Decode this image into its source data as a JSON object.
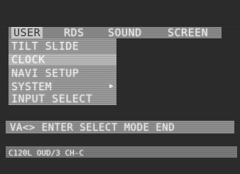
{
  "menu": {
    "tabs": [
      {
        "label": "USER"
      },
      {
        "label": "RDS"
      },
      {
        "label": "SOUND"
      },
      {
        "label": "SCREEN"
      }
    ],
    "active_tab": "USER"
  },
  "dropdown": {
    "items": [
      {
        "label": "TILT SLIDE"
      },
      {
        "label": "CLOCK"
      },
      {
        "label": "NAVI SETUP"
      },
      {
        "label": "SYSTEM"
      },
      {
        "label": "INPUT SELECT"
      }
    ],
    "selected_item": "CLOCK",
    "submenu_arrow_icon": "triangle-right-icon",
    "submenu_arrow_glyph": "▶"
  },
  "help_bar": {
    "text": "VA<> ENTER SELECT MODE END"
  },
  "status_bar": {
    "text": "C120L OUD/3 CH-C"
  },
  "colors": {
    "screen_bg": "#2d2d2d",
    "bar_bg": "#8a8a8a",
    "highlight_bg": "#b9b9b9",
    "text": "#f2f2f2"
  }
}
